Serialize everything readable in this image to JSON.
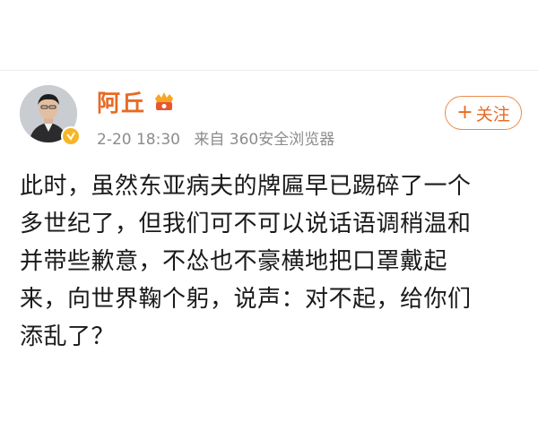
{
  "post": {
    "author": {
      "name": "阿丘"
    },
    "meta": {
      "time": "2-20 18:30",
      "source": "来自 360安全浏览器"
    },
    "follow_button": {
      "plus": "+",
      "label": "关注"
    },
    "content_lines": [
      "此时，虽然东亚病夫的牌匾早已踢碎了一个",
      "多世纪了，但我们可不可以说话语调稍温和",
      "并带些歉意，不怂也不豪横地把口罩戴起",
      "来，向世界鞠个躬，说声：对不起，给你们",
      "添乱了？"
    ]
  },
  "colors": {
    "accent": "#e86a23",
    "meta_text": "#8c8c8c",
    "verified_badge": "#f6b626"
  },
  "icons": {
    "verified": "verified-badge-icon",
    "vip": "vip-crown-icon"
  }
}
